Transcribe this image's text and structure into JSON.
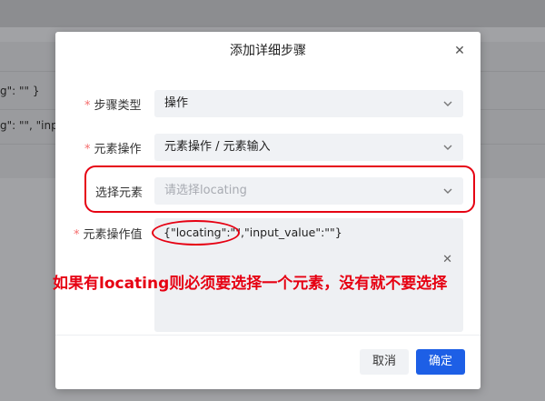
{
  "background": {
    "line1": "g\": \"\" }",
    "line2": "g\": \"\", \"inp"
  },
  "dialog": {
    "title": "添加详细步骤",
    "close_icon": "close-icon",
    "fields": {
      "step_type": {
        "label": "步骤类型",
        "value": "操作"
      },
      "element_operation": {
        "label": "元素操作",
        "value": "元素操作 / 元素输入"
      },
      "select_element": {
        "label": "选择元素",
        "placeholder": "请选择locating"
      },
      "element_operation_value": {
        "label": "元素操作值",
        "value": "{\"locating\":\"\",\"input_value\":\"\"}"
      }
    },
    "buttons": {
      "cancel": "取消",
      "confirm": "确定"
    }
  },
  "annotation": {
    "note": "如果有locating则必须要选择一个元素，没有就不要选择",
    "color": "#e60012"
  },
  "colors": {
    "primary": "#1d5fe6",
    "required": "#f56c6c"
  }
}
